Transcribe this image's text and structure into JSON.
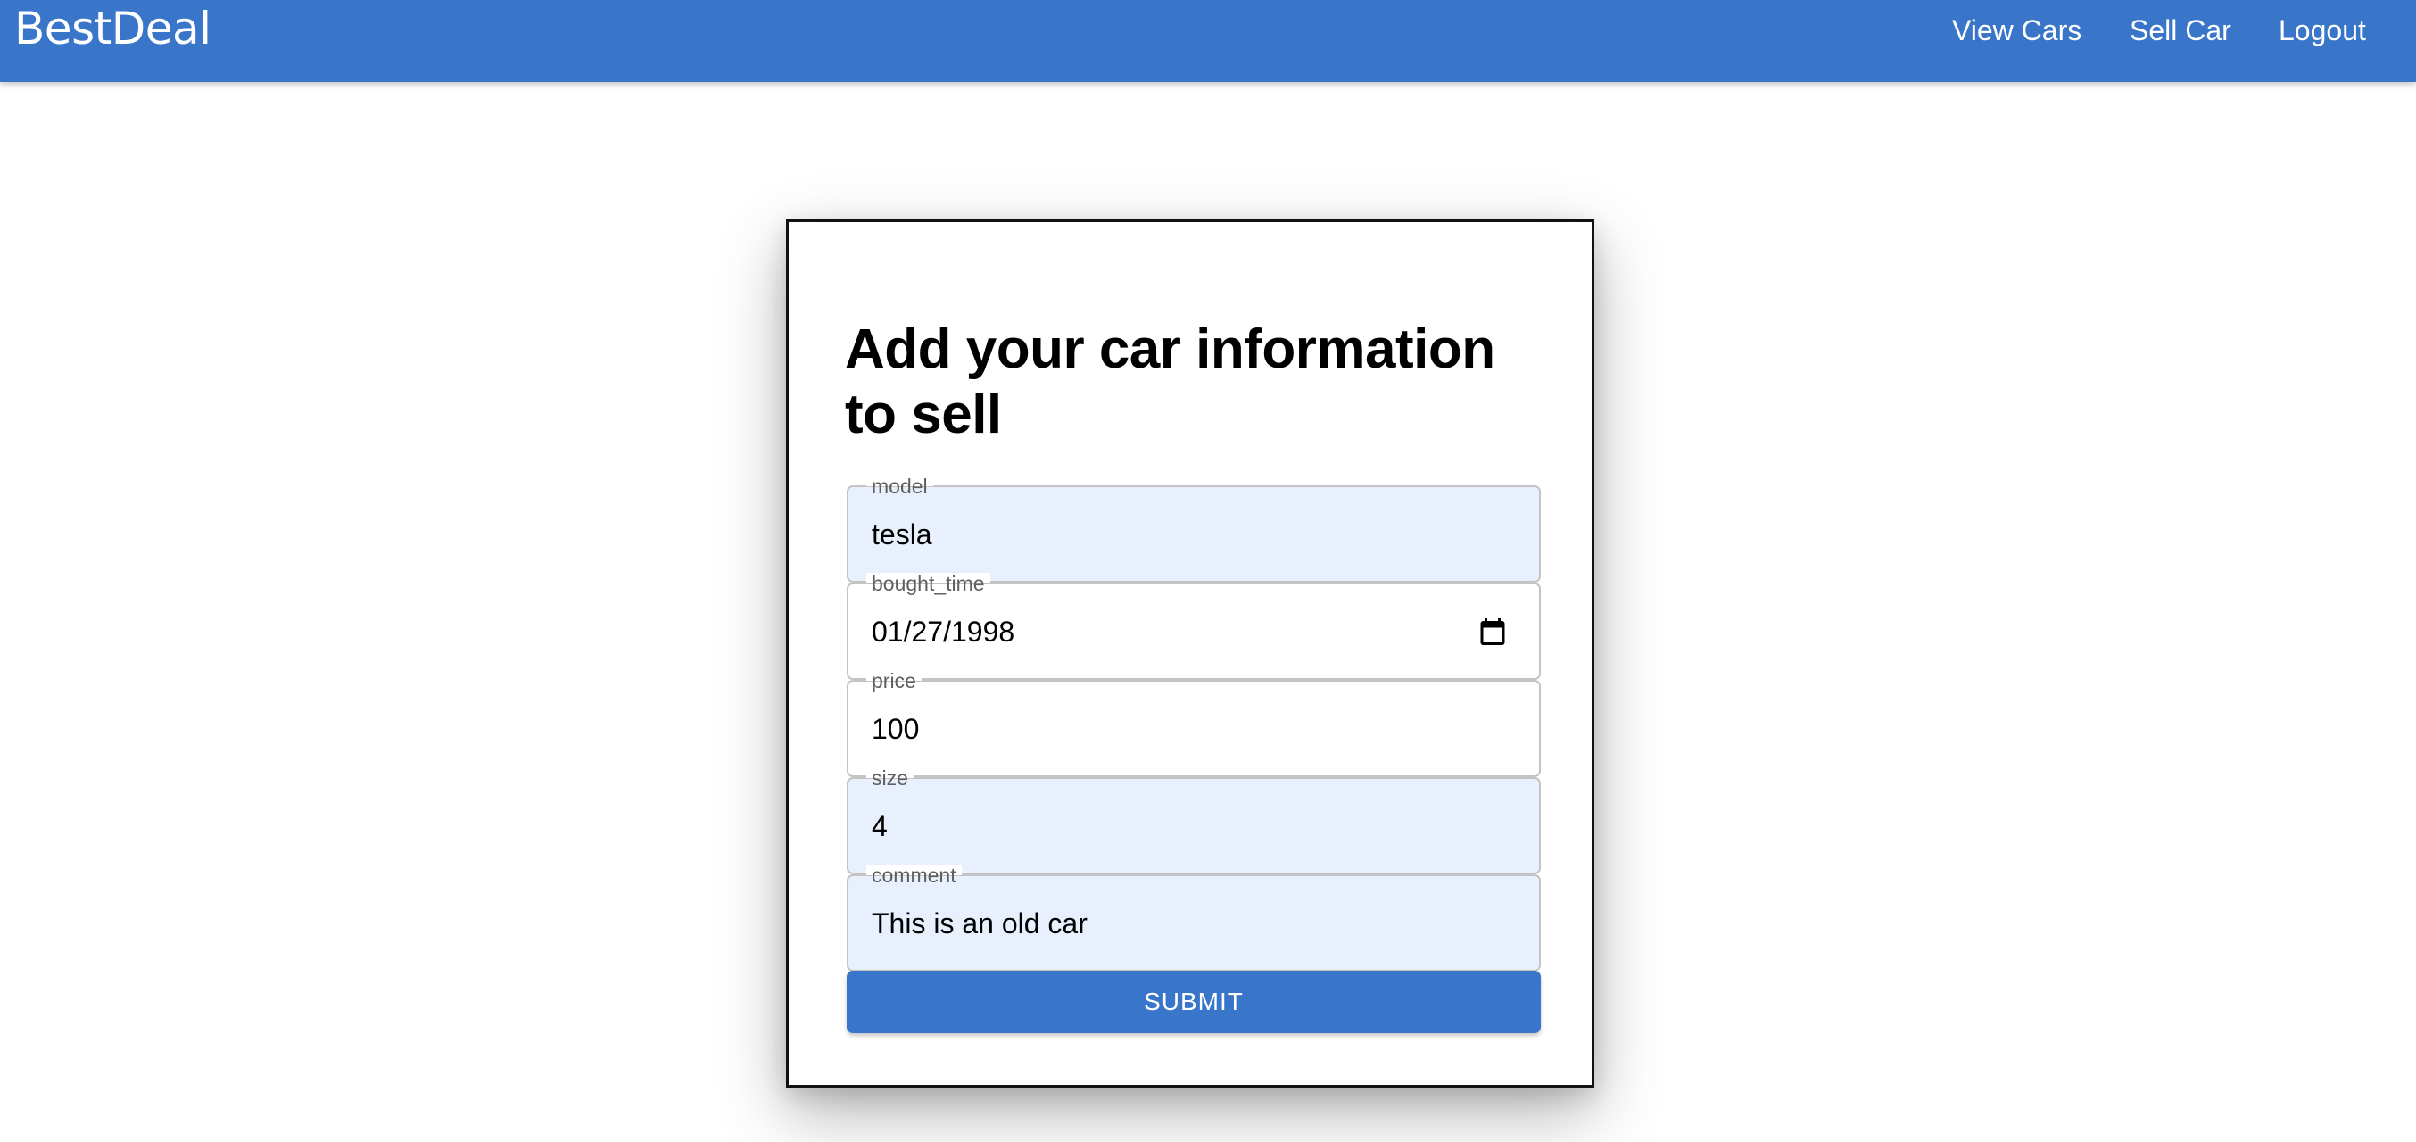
{
  "appbar": {
    "brand": "BestDeal",
    "nav": {
      "view_cars": "View Cars",
      "sell_car": "Sell Car",
      "logout": "Logout"
    },
    "color": "#3976c9"
  },
  "form": {
    "title": "Add your car information to sell",
    "fields": [
      {
        "label": "model",
        "value": "tesla"
      },
      {
        "label": "bought_time",
        "value": "01/27/1998",
        "icon": "calendar-icon"
      },
      {
        "label": "price",
        "value": "100"
      },
      {
        "label": "size",
        "value": "4"
      },
      {
        "label": "comment",
        "value": "This is an old car"
      }
    ],
    "submit_label": "SUBMIT"
  }
}
